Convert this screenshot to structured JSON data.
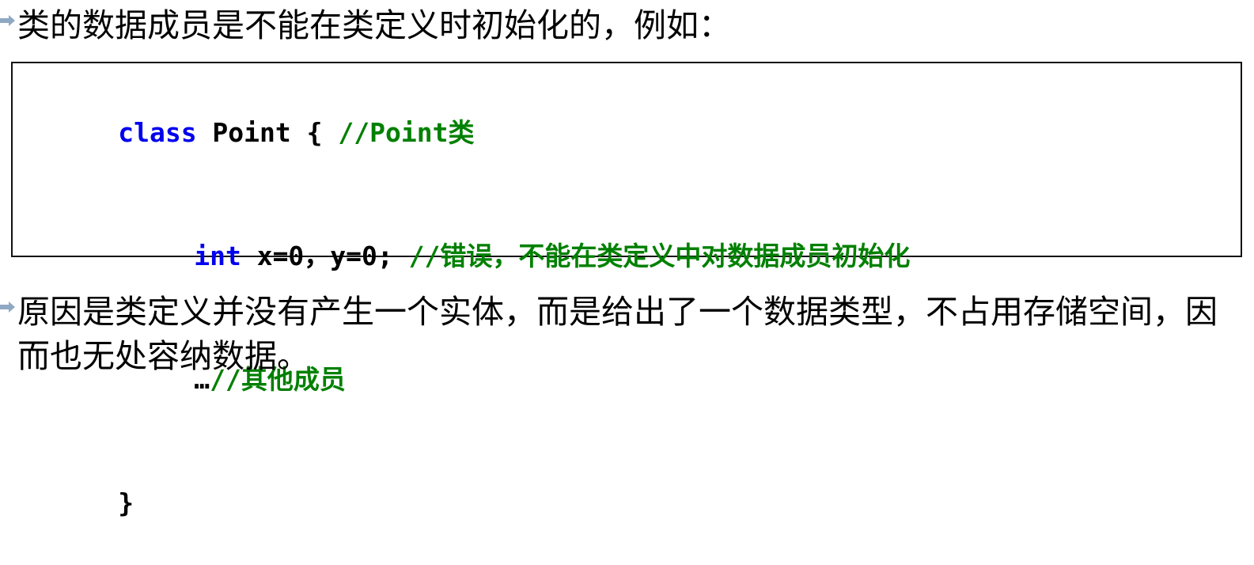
{
  "slide": {
    "background_color": "#ffffff",
    "bullet_marker_color": "#8fa9c4",
    "bullet_marker_name": "arrow-bullet-icon"
  },
  "paragraphs": {
    "intro": {
      "text": "类的数据成员是不能在类定义时初始化的，例如："
    },
    "reason": {
      "text": "原因是类定义并没有产生一个实体，而是给出了一个数据类型，不占用存储空间，因而也无处容纳数据。"
    }
  },
  "code_box": {
    "border_color": "#111111",
    "keyword_color": "#0000ee",
    "text_color": "#000000",
    "comment_color": "#008000",
    "lines": [
      {
        "indent": false,
        "tokens": [
          {
            "type": "keyword",
            "text": "class"
          },
          {
            "type": "text",
            "text": " Point { "
          },
          {
            "type": "comment",
            "text": "//Point类"
          }
        ]
      },
      {
        "indent": true,
        "tokens": [
          {
            "type": "keyword",
            "text": "int"
          },
          {
            "type": "text",
            "text": " x=0，y=0; "
          },
          {
            "type": "comment",
            "text": "//错误，不能在类定义中对数据成员初始化"
          }
        ]
      },
      {
        "indent": true,
        "tokens": [
          {
            "type": "text",
            "text": "…"
          },
          {
            "type": "comment",
            "text": "//其他成员"
          }
        ]
      },
      {
        "indent": false,
        "tokens": [
          {
            "type": "text",
            "text": "}"
          }
        ]
      }
    ]
  }
}
